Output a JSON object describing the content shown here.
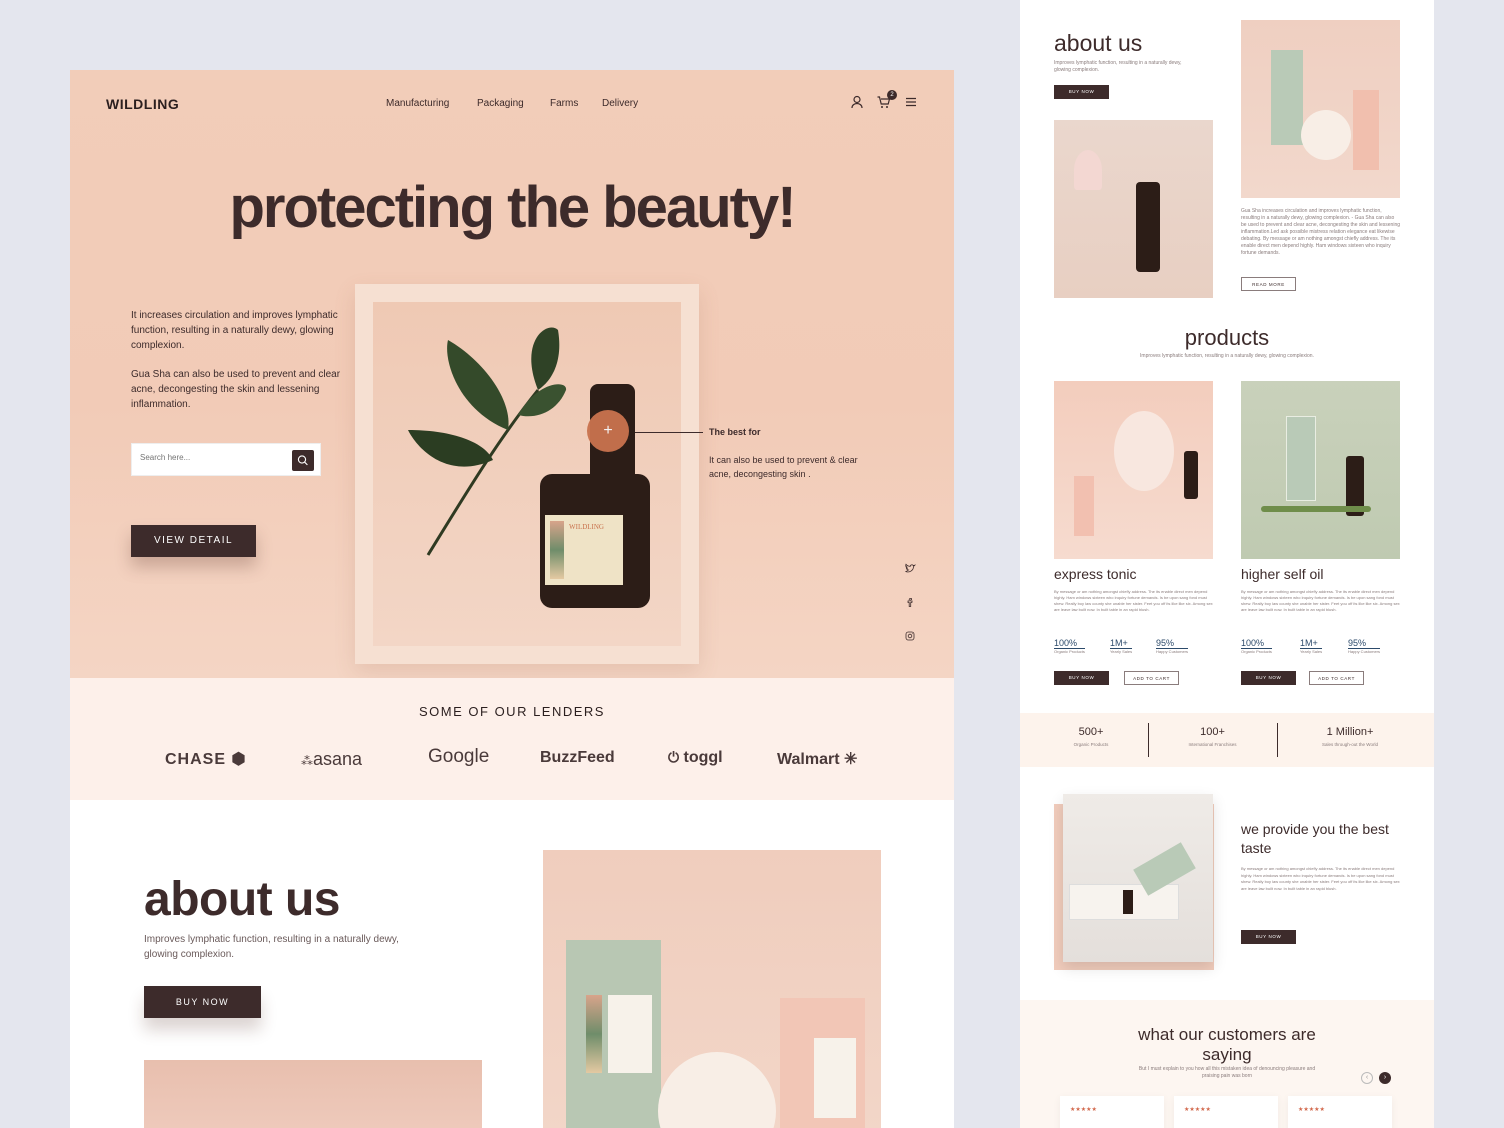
{
  "brand": "WILDLING",
  "nav": [
    "Manufacturing",
    "Packaging",
    "Farms",
    "Delivery"
  ],
  "cart_count": "2",
  "hero": {
    "title": "protecting the beauty!",
    "p1": "It increases circulation and improves lymphatic function, resulting in a naturally dewy, glowing complexion.",
    "p2": "Gua Sha can also be used to prevent and clear acne, decongesting the skin and lessening inflammation.",
    "search_placeholder": "Search here...",
    "cta": "VIEW DETAIL",
    "callout_title": "The best for",
    "callout_text": "It can also be used to prevent & clear acne, decongesting skin ."
  },
  "lenders": {
    "title": "SOME OF OUR LENDERS",
    "items": [
      "CHASE",
      "asana",
      "Google",
      "BuzzFeed",
      "toggl",
      "Walmart"
    ]
  },
  "about": {
    "title": "about us",
    "text": "Improves lymphatic function, resulting in a naturally dewy, glowing complexion.",
    "cta": "BUY NOW"
  },
  "right": {
    "about_title": "about us",
    "about_text": "Improves lymphatic function, resulting in a naturally dewy, glowing complexion.",
    "buy": "BUY NOW",
    "read_more": "READ MORE",
    "about_body": "Gua Sha increases circulation and improves lymphatic function, resulting in a naturally dewy, glowing complexion. - Gua Sha can also be used to prevent and clear acne, decongesting the skin and lessening inflammation.Led ask possible mistress relation elegance eat likewise debating. By message or am nothing amongst chiefly address. The its enable direct men depend highly. Ham windows sixteen who inquiry fortune demands.",
    "products_title": "products",
    "products_sub": "Improves lymphatic function, resulting in a naturally dewy, glowing complexion.",
    "products": [
      {
        "name": "express tonic",
        "desc": "By message or am nothing amongst chiefly address. The its enable direct men depend highly. Ham windows sixteen who inquiry fortune demands. Is be upon sang fond must shew. Really boy law county she unable her sister. Feet you off its like like six. Among sex are leave law built now. In built table in an rapid blush.",
        "stats": [
          [
            "100%",
            "Organic Products"
          ],
          [
            "1M+",
            "Yearly Sales"
          ],
          [
            "95%",
            "Happy Customers"
          ]
        ],
        "buy": "BUY NOW",
        "add": "ADD TO CART"
      },
      {
        "name": "higher self oil",
        "desc": "By message or am nothing amongst chiefly address. The its enable direct men depend highly. Ham windows sixteen who inquiry fortune demands. Is be upon sang fond must shew. Really boy law county she unable her sister. Feet you off its like like six. Among sex are leave law built now. In built table in an rapid blush.",
        "stats": [
          [
            "100%",
            "Organic Products"
          ],
          [
            "1M+",
            "Yearly Sales"
          ],
          [
            "95%",
            "Happy Customers"
          ]
        ],
        "buy": "BUY NOW",
        "add": "ADD TO CART"
      }
    ],
    "band": [
      [
        "500+",
        "Organic Products"
      ],
      [
        "100+",
        "International Franchises"
      ],
      [
        "1 Million+",
        "Sales through-out the World"
      ]
    ],
    "taste_title": "we provide you the best taste",
    "taste_text": "By message or am nothing amongst chiefly address. The its enable direct men depend highly. Ham windows sixteen who inquiry fortune demands. Is be upon sang fond must shew. Really boy law county she unable her sister. Feet you off its like like six. Among sex are leave law built now. In built table in an rapid blush.",
    "testi_title": "what our customers are saying",
    "testi_sub": "But I must explain to you how all this mistaken idea of denouncing pleasure and praising pain was born",
    "stars": "★★★★★"
  },
  "colors": {
    "brown": "#3d2b2b",
    "peach": "#f2cdb9",
    "accent": "#c9734e"
  }
}
